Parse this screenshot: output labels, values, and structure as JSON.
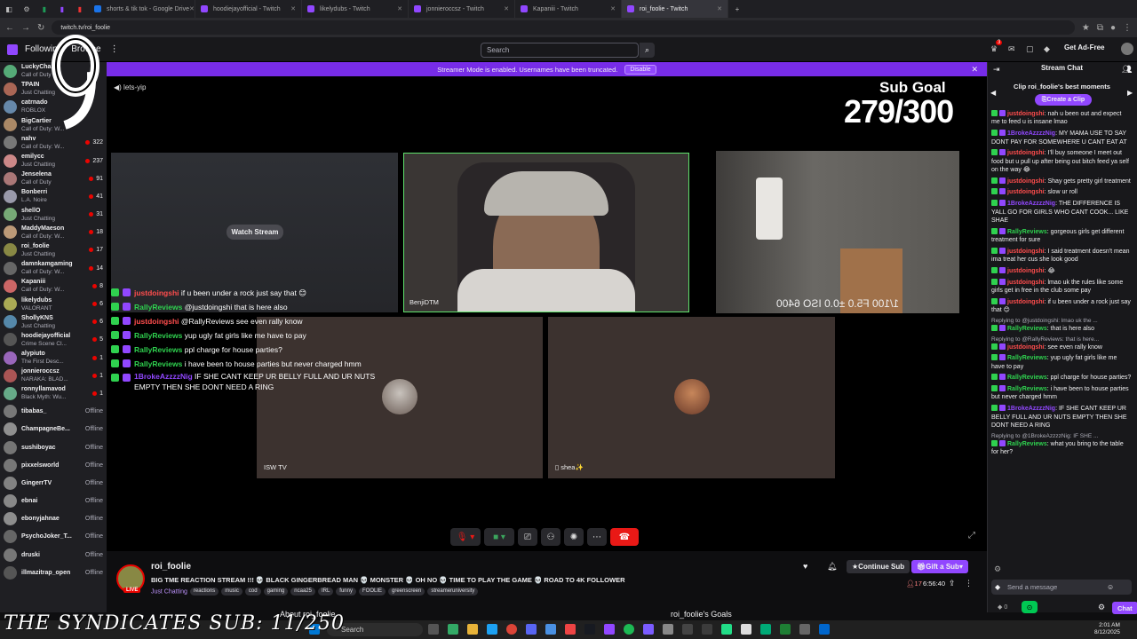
{
  "browser": {
    "tabs": [
      {
        "label": "shorts & tik tok - Google Drive",
        "color": "#1a73e8"
      },
      {
        "label": "hoodiejayofficial - Twitch",
        "color": "#9147ff"
      },
      {
        "label": "likelydubs - Twitch",
        "color": "#9147ff"
      },
      {
        "label": "jonnieroccsz - Twitch",
        "color": "#9147ff"
      },
      {
        "label": "Kapaniii - Twitch",
        "color": "#9147ff"
      },
      {
        "label": "roi_foolie - Twitch",
        "color": "#9147ff"
      }
    ],
    "url": "twitch.tv/roi_foolie"
  },
  "topnav": {
    "following": "Following",
    "browse": "Browse",
    "search_placeholder": "Search",
    "get_ad_free": "Get Ad-Free",
    "notif_count": "3"
  },
  "sidebar": {
    "channels": [
      {
        "name": "LuckyCha...",
        "game": "Call of Duty",
        "viewers": "",
        "color": "#5a7"
      },
      {
        "name": "TPAIN",
        "game": "Just Chatting",
        "viewers": "",
        "color": "#a65"
      },
      {
        "name": "catrnado",
        "game": "ROBLOX",
        "viewers": "",
        "color": "#68a"
      },
      {
        "name": "BigCartier",
        "game": "Call of Duty: W...",
        "viewers": "",
        "color": "#a86"
      },
      {
        "name": "nahv",
        "game": "Call of Duty: W...",
        "viewers": "322",
        "color": "#777"
      },
      {
        "name": "emilycc",
        "game": "Just Chatting",
        "viewers": "237",
        "color": "#c88"
      },
      {
        "name": "Jenselena",
        "game": "Call of Duty",
        "viewers": "91",
        "color": "#a77"
      },
      {
        "name": "Bonberri",
        "game": "L.A. Noire",
        "viewers": "41",
        "color": "#99a"
      },
      {
        "name": "shellO",
        "game": "Just Chatting",
        "viewers": "31",
        "color": "#7a7"
      },
      {
        "name": "MaddyMaeson",
        "game": "Call of Duty: W...",
        "viewers": "18",
        "color": "#b97"
      },
      {
        "name": "roi_foolie",
        "game": "Just Chatting",
        "viewers": "17",
        "color": "#884"
      },
      {
        "name": "damnkamgaming",
        "game": "Call of Duty: W...",
        "viewers": "14",
        "color": "#666"
      },
      {
        "name": "Kapaniii",
        "game": "Call of Duty: W...",
        "viewers": "8",
        "color": "#c66"
      },
      {
        "name": "likelydubs",
        "game": "VALORANT",
        "viewers": "6",
        "color": "#aa5"
      },
      {
        "name": "ShollyKNS",
        "game": "Just Chatting",
        "viewers": "6",
        "color": "#58a"
      },
      {
        "name": "hoodiejayofficial",
        "game": "Crime Scene Cl...",
        "viewers": "5",
        "color": "#555"
      },
      {
        "name": "alypiuto",
        "game": "The First Desc...",
        "viewers": "1",
        "color": "#96b"
      },
      {
        "name": "jonnieroccsz",
        "game": "NARAKA: BLAD...",
        "viewers": "1",
        "color": "#a55"
      },
      {
        "name": "ronnyllamavod",
        "game": "Black Myth: Wu...",
        "viewers": "1",
        "color": "#6a8"
      },
      {
        "name": "tibabas_",
        "game": "",
        "viewers": "Offline",
        "color": "#777"
      },
      {
        "name": "ChampagneBe...",
        "game": "",
        "viewers": "Offline",
        "color": "#a88"
      },
      {
        "name": "sushiboyac",
        "game": "",
        "viewers": "Offline",
        "color": "#678"
      },
      {
        "name": "pixxelsworld",
        "game": "",
        "viewers": "Offline",
        "color": "#777"
      },
      {
        "name": "GingerrTV",
        "game": "",
        "viewers": "Offline",
        "color": "#b74"
      },
      {
        "name": "ebnai",
        "game": "",
        "viewers": "Offline",
        "color": "#888"
      },
      {
        "name": "ebonyjahnae",
        "game": "",
        "viewers": "Offline",
        "color": "#a86"
      },
      {
        "name": "PsychoJoker_T...",
        "game": "",
        "viewers": "Offline",
        "color": "#666"
      },
      {
        "name": "druski",
        "game": "",
        "viewers": "Offline",
        "color": "#777"
      },
      {
        "name": "illmazitrap_open",
        "game": "",
        "viewers": "Offline",
        "color": "#555"
      }
    ]
  },
  "banner": {
    "text": "Streamer Mode is enabled. Usernames have been truncated.",
    "disable": "Disable"
  },
  "player": {
    "sound_label": "lets-yip",
    "sub_goal_label": "Sub Goal",
    "sub_goal_count": "279/300",
    "watch_stream": "Watch Stream",
    "tile_b_label": "BenjiDTM",
    "tile_d_label": "ISW TV",
    "tile_e_label": "shea✨",
    "camera_readout": "1/100   F5.0   ±0.0   ISO 6400"
  },
  "overlay_chat": [
    {
      "user": "justdoingshi",
      "color": "#ff4d4d",
      "text": "if u been under a rock just say that 😊"
    },
    {
      "user": "RallyReviews",
      "color": "#2fd14f",
      "text": "@justdoingshi that is here also"
    },
    {
      "user": "justdoingshi",
      "color": "#ff4d4d",
      "text": "@RallyReviews see even rally know"
    },
    {
      "user": "RallyReviews",
      "color": "#2fd14f",
      "text": "yup ugly fat girls like me have to pay"
    },
    {
      "user": "RallyReviews",
      "color": "#2fd14f",
      "text": "ppl charge for house parties?"
    },
    {
      "user": "RallyReviews",
      "color": "#2fd14f",
      "text": "i have been to house parties but never charged hmm"
    },
    {
      "user": "1BrokeAzzzzNig",
      "color": "#9147ff",
      "text": "IF SHE CANT KEEP UR BELLY FULL AND UR NUTS EMPTY THEN SHE DONT NEED A RING"
    }
  ],
  "stream_info": {
    "channel": "roi_foolie",
    "title": "BIG TME REACTION STREAM !!! 💀 BLACK GINGERBREAD MAN 💀 MONSTER 💀 OH NO 💀 TIME TO PLAY THE GAME 💀 ROAD TO 4K FOLLOWER",
    "category": "Just Chatting",
    "tags": [
      "reactions",
      "music",
      "cod",
      "gaming",
      "ncaa25",
      "IRL",
      "funny",
      "FOOLIE",
      "greenscreen",
      "streameruniversity"
    ],
    "live": "LIVE",
    "continue_sub": "Continue Sub",
    "gift_sub": "Gift a Sub",
    "viewers": "17",
    "uptime": "6:56:40",
    "about": "About roi_foolie",
    "goals": "roi_foolie's Goals"
  },
  "chat": {
    "title": "Stream Chat",
    "clip_title": "Clip roi_foolie's best moments",
    "create_clip": "Create a Clip",
    "placeholder": "Send a message",
    "send": "Chat",
    "points": "0",
    "messages": [
      {
        "reply": "",
        "user": "justdoingshi",
        "color": "#ff4d4d",
        "text": "nah u been out and expect me to feed u is insane lmao"
      },
      {
        "reply": "",
        "user": "1BrokeAzzzzNig",
        "color": "#9147ff",
        "text": "MY MAMA USE TO SAY DONT PAY FOR SOMEWHERE U CANT EAT AT"
      },
      {
        "reply": "",
        "user": "justdoingshi",
        "color": "#ff4d4d",
        "text": "I'll buy someone I meet out food but u pull up after being out bitch feed ya self on the way 😂"
      },
      {
        "reply": "",
        "user": "justdoingshi",
        "color": "#ff4d4d",
        "text": "Shay gets pretty girl treatment"
      },
      {
        "reply": "",
        "user": "justdoingshi",
        "color": "#ff4d4d",
        "text": "slow ur roll"
      },
      {
        "reply": "",
        "user": "1BrokeAzzzzNig",
        "color": "#9147ff",
        "text": "THE DIFFERENCE IS YALL GO FOR GIRLS WHO CANT COOK... LIKE SHAE"
      },
      {
        "reply": "",
        "user": "RallyReviews",
        "color": "#2fd14f",
        "text": "gorgeous girls get different treatment for sure"
      },
      {
        "reply": "",
        "user": "justdoingshi",
        "color": "#ff4d4d",
        "text": "I said treatment doesn't mean ima treat her cus she look good"
      },
      {
        "reply": "",
        "user": "justdoingshi",
        "color": "#ff4d4d",
        "text": "😂"
      },
      {
        "reply": "",
        "user": "justdoingshi",
        "color": "#ff4d4d",
        "text": "lmao uk the rules like some girls get in free in the club some pay"
      },
      {
        "reply": "",
        "user": "justdoingshi",
        "color": "#ff4d4d",
        "text": "if u been under a rock just say that 😊"
      },
      {
        "reply": "Replying to @justdoingshi: lmao uk the ...",
        "user": "RallyReviews",
        "color": "#2fd14f",
        "text": "that is here also"
      },
      {
        "reply": "Replying to @RallyReviews: that is here...",
        "user": "justdoingshi",
        "color": "#ff4d4d",
        "text": "see even rally know"
      },
      {
        "reply": "",
        "user": "RallyReviews",
        "color": "#2fd14f",
        "text": "yup ugly fat girls like me have to pay"
      },
      {
        "reply": "",
        "user": "RallyReviews",
        "color": "#2fd14f",
        "text": "ppl charge for house parties?"
      },
      {
        "reply": "",
        "user": "RallyReviews",
        "color": "#2fd14f",
        "text": "i have been to house parties but never charged hmm"
      },
      {
        "reply": "",
        "user": "1BrokeAzzzzNig",
        "color": "#9147ff",
        "text": "IF SHE CANT KEEP UR BELLY FULL AND UR NUTS EMPTY THEN SHE DONT NEED A RING"
      },
      {
        "reply": "Replying to @1BrokeAzzzzNig: IF SHE ...",
        "user": "RallyReviews",
        "color": "#2fd14f",
        "text": "what you bring to the table for her?"
      }
    ]
  },
  "taskbar": {
    "overlay_text": "THE SYNDICATES SUB: 11/250",
    "search": "Search",
    "time": "2:01 AM",
    "date": "8/12/2025"
  }
}
